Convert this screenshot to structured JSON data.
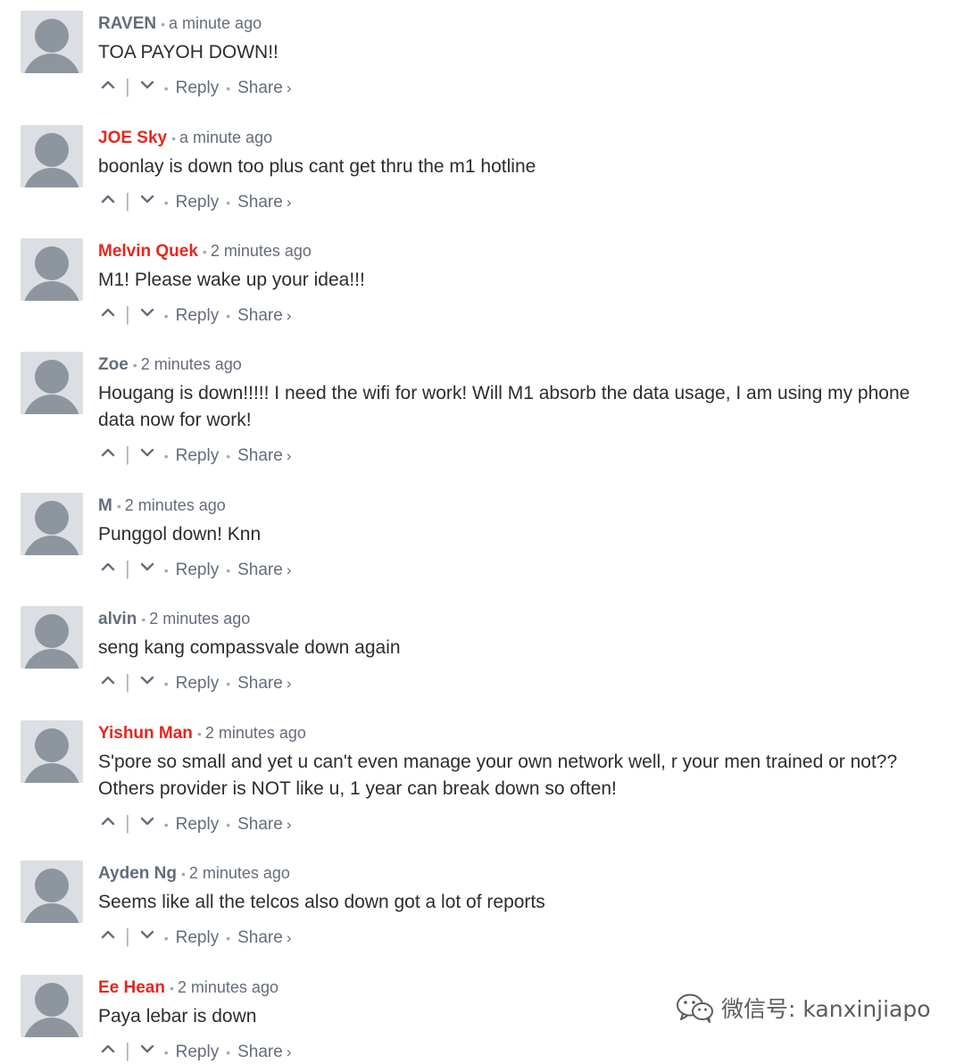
{
  "comments": [
    {
      "author": "RAVEN",
      "author_red": false,
      "time": "a minute ago",
      "lines": [
        "TOA PAYOH DOWN!!"
      ]
    },
    {
      "author": "JOE Sky",
      "author_red": true,
      "time": "a minute ago",
      "lines": [
        "boonlay is down too plus cant get thru the m1 hotline"
      ]
    },
    {
      "author": "Melvin Quek",
      "author_red": true,
      "time": "2 minutes ago",
      "lines": [
        "M1! Please wake up your idea!!!"
      ]
    },
    {
      "author": "Zoe",
      "author_red": false,
      "time": "2 minutes ago",
      "lines": [
        "Hougang is down!!!!! I need the wifi for work! Will M1 absorb the data usage, I am using my phone",
        "data now for work!"
      ]
    },
    {
      "author": "M",
      "author_red": false,
      "time": "2 minutes ago",
      "lines": [
        "Punggol down! Knn"
      ]
    },
    {
      "author": "alvin",
      "author_red": false,
      "time": "2 minutes ago",
      "lines": [
        "seng kang compassvale down again"
      ]
    },
    {
      "author": "Yishun Man",
      "author_red": true,
      "time": "2 minutes ago",
      "lines": [
        "S'pore so small and yet u can't even manage your own network well, r your men trained or not??",
        "Others provider is NOT like u, 1 year can break down so often!"
      ]
    },
    {
      "author": "Ayden Ng",
      "author_red": false,
      "time": "2 minutes ago",
      "lines": [
        "Seems like all the telcos also down got a lot of reports"
      ]
    },
    {
      "author": "Ee Hean",
      "author_red": true,
      "time": "2 minutes ago",
      "lines": [
        "Paya lebar is down"
      ]
    }
  ],
  "actions": {
    "reply_label": "Reply",
    "share_label": "Share",
    "upvote_icon": "chevron-up-icon",
    "downvote_icon": "chevron-down-icon",
    "share_chevron": "›"
  },
  "colors": {
    "author_default": "#656c7a",
    "author_highlight": "#e8261e",
    "body_text": "#2a2e2e",
    "avatar_bg": "#dbdfe4",
    "avatar_fg": "#8d959e"
  },
  "watermark": {
    "label": "微信号: kanxinjiapo",
    "icon": "wechat-icon"
  }
}
